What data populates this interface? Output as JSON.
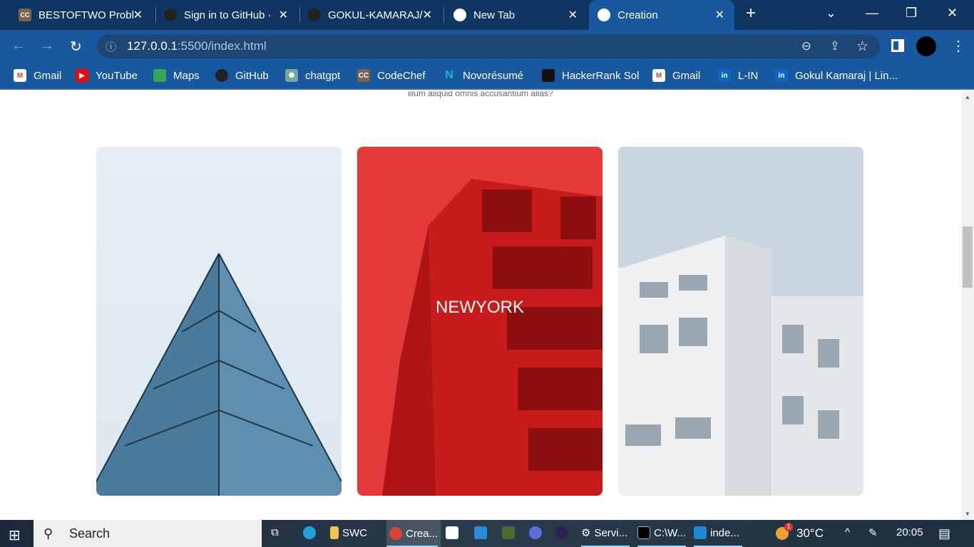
{
  "browser": {
    "tabs": [
      {
        "label": "BESTOFTWO Probl",
        "icon": "codechef-icon",
        "active": false
      },
      {
        "label": "Sign in to GitHub ·",
        "icon": "github-icon",
        "active": false
      },
      {
        "label": "GOKUL-KAMARAJ/",
        "icon": "github-icon",
        "active": false
      },
      {
        "label": "New Tab",
        "icon": "chrome-icon",
        "active": false
      },
      {
        "label": "Creation",
        "icon": "globe-icon",
        "active": true
      }
    ],
    "url_host": "127.0.0.1",
    "url_rest": ":5500/index.html",
    "bookmarks": [
      {
        "label": "Gmail",
        "icon": "gmail-icon",
        "color": "#ea4335"
      },
      {
        "label": "YouTube",
        "icon": "youtube-icon",
        "color": "#ff0000"
      },
      {
        "label": "Maps",
        "icon": "maps-icon",
        "color": "#34a853"
      },
      {
        "label": "GitHub",
        "icon": "github-icon",
        "color": "#222222"
      },
      {
        "label": "chatgpt",
        "icon": "chatgpt-icon",
        "color": "#74aa9c"
      },
      {
        "label": "CodeChef",
        "icon": "codechef-icon",
        "color": "#5b4638"
      },
      {
        "label": "Novorésumé",
        "icon": "novoresume-icon",
        "color": "#19b5c9"
      },
      {
        "label": "HackerRank Sol",
        "icon": "hackerrank-icon",
        "color": "#111111"
      },
      {
        "label": "Gmail",
        "icon": "gmail-icon",
        "color": "#ea4335"
      },
      {
        "label": "L-IN",
        "icon": "linkedin-icon",
        "color": "#0a66c2"
      },
      {
        "label": "Gokul Kamaraj | Lin...",
        "icon": "linkedin-icon",
        "color": "#0a66c2"
      }
    ]
  },
  "page": {
    "subtitle": "illum aliquid omnis accusantium alias?",
    "cards": [
      {
        "label": ""
      },
      {
        "label": "NEWYORK"
      },
      {
        "label": ""
      }
    ]
  },
  "taskbar": {
    "search": "Search",
    "apps": [
      "SWC",
      "Crea...",
      "Servi...",
      "C:\\W...",
      "inde..."
    ],
    "weather": "30°C",
    "weather_badge": "1",
    "time": "20:05"
  }
}
